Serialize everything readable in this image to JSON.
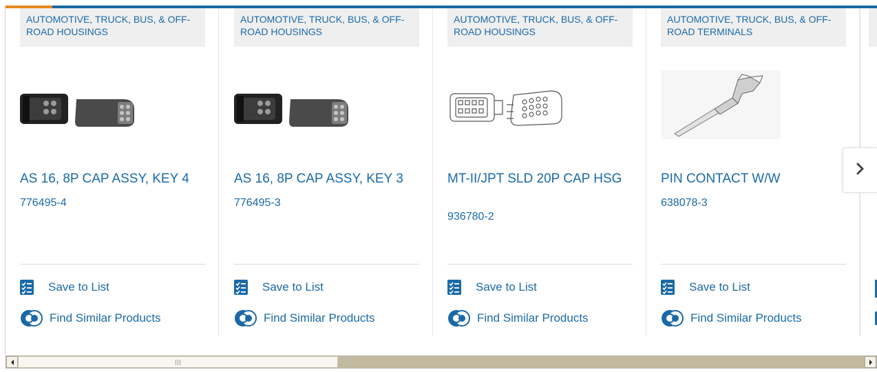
{
  "carousel": {
    "cards": [
      {
        "category": "AUTOMOTIVE, TRUCK, BUS, & OFF-ROAD HOUSINGS",
        "image_icon": "connector-housing-pair-icon",
        "title": "AS 16, 8P CAP ASSY, KEY 4",
        "part_number": "776495-4",
        "save_label": "Save to List",
        "similar_label": "Find Similar Products"
      },
      {
        "category": "AUTOMOTIVE, TRUCK, BUS, & OFF-ROAD HOUSINGS",
        "image_icon": "connector-housing-pair-icon",
        "title": "AS 16, 8P CAP ASSY, KEY 3",
        "part_number": "776495-3",
        "save_label": "Save to List",
        "similar_label": "Find Similar Products"
      },
      {
        "category": "AUTOMOTIVE, TRUCK, BUS, & OFF-ROAD HOUSINGS",
        "image_icon": "connector-line-drawing-icon",
        "title": "MT-II/JPT SLD 20P CAP HSG",
        "part_number": "936780-2",
        "save_label": "Save to List",
        "similar_label": "Find Similar Products"
      },
      {
        "category": "AUTOMOTIVE, TRUCK, BUS, & OFF-ROAD TERMINALS",
        "image_icon": "pin-contact-icon",
        "title": "PIN CONTACT W/W",
        "part_number": "638078-3",
        "save_label": "Save to List",
        "similar_label": "Find Similar Products"
      }
    ],
    "next_icon": "chevron-right-icon"
  },
  "icons": {
    "save": "checklist-icon",
    "similar": "find-similar-icon",
    "scroll_left": "scroll-left-arrow-icon",
    "scroll_right": "scroll-right-arrow-icon"
  },
  "colors": {
    "link": "#1a69a7",
    "accent": "#e8871e",
    "category_bg": "#efefef"
  }
}
